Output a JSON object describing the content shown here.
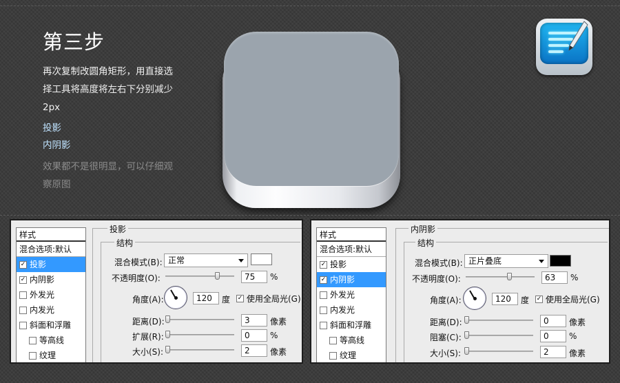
{
  "header": {
    "step_title": "第三步",
    "description": "再次复制改圆角矩形，用直接选择工具将高度将左右下分别减少2px",
    "effects": [
      "投影",
      "内阴影"
    ],
    "note": "效果都不是很明显，可以仔细观察原图"
  },
  "icon_names": {
    "big_icon": "rounded-square-icon",
    "app_icon": "notepad-pencil-app-icon"
  },
  "style_list": {
    "header": "样式",
    "blend": "混合选项:默认",
    "items": [
      "投影",
      "内阴影",
      "外发光",
      "内发光",
      "斜面和浮雕"
    ],
    "sub_items": [
      "等高线",
      "纹理"
    ]
  },
  "panel_left": {
    "group_title": "投影",
    "sub_title": "结构",
    "checked": [
      true,
      true,
      false,
      false,
      false,
      false,
      false
    ],
    "selected_index": 0,
    "blend_mode_label": "混合模式(B):",
    "blend_mode_value": "正常",
    "swatch_color": "#ffffff",
    "opacity_label": "不透明度(O):",
    "opacity_value": "75",
    "opacity_fraction": 0.75,
    "percent": "%",
    "angle_label": "角度(A):",
    "angle_value": "120",
    "angle_unit": "度",
    "global_light_label": "使用全局光(G)",
    "global_light_checked": true,
    "distance_label": "距离(D):",
    "distance_value": "3",
    "spread_label": "扩展(R):",
    "spread_value": "0",
    "size_label": "大小(S):",
    "size_value": "2",
    "px_unit": "像素"
  },
  "panel_right": {
    "group_title": "内阴影",
    "sub_title": "结构",
    "checked": [
      true,
      true,
      false,
      false,
      false,
      false,
      false
    ],
    "selected_index": 1,
    "blend_mode_label": "混合模式(B):",
    "blend_mode_value": "正片叠底",
    "swatch_color": "#000000",
    "opacity_label": "不透明度(O):",
    "opacity_value": "63",
    "opacity_fraction": 0.63,
    "percent": "%",
    "angle_label": "角度(A):",
    "angle_value": "120",
    "angle_unit": "度",
    "global_light_label": "使用全局光(G)",
    "global_light_checked": true,
    "distance_label": "距离(D):",
    "distance_value": "0",
    "choke_label": "阻塞(C):",
    "choke_value": "0",
    "size_label": "大小(S):",
    "size_value": "2",
    "px_unit": "像素"
  }
}
